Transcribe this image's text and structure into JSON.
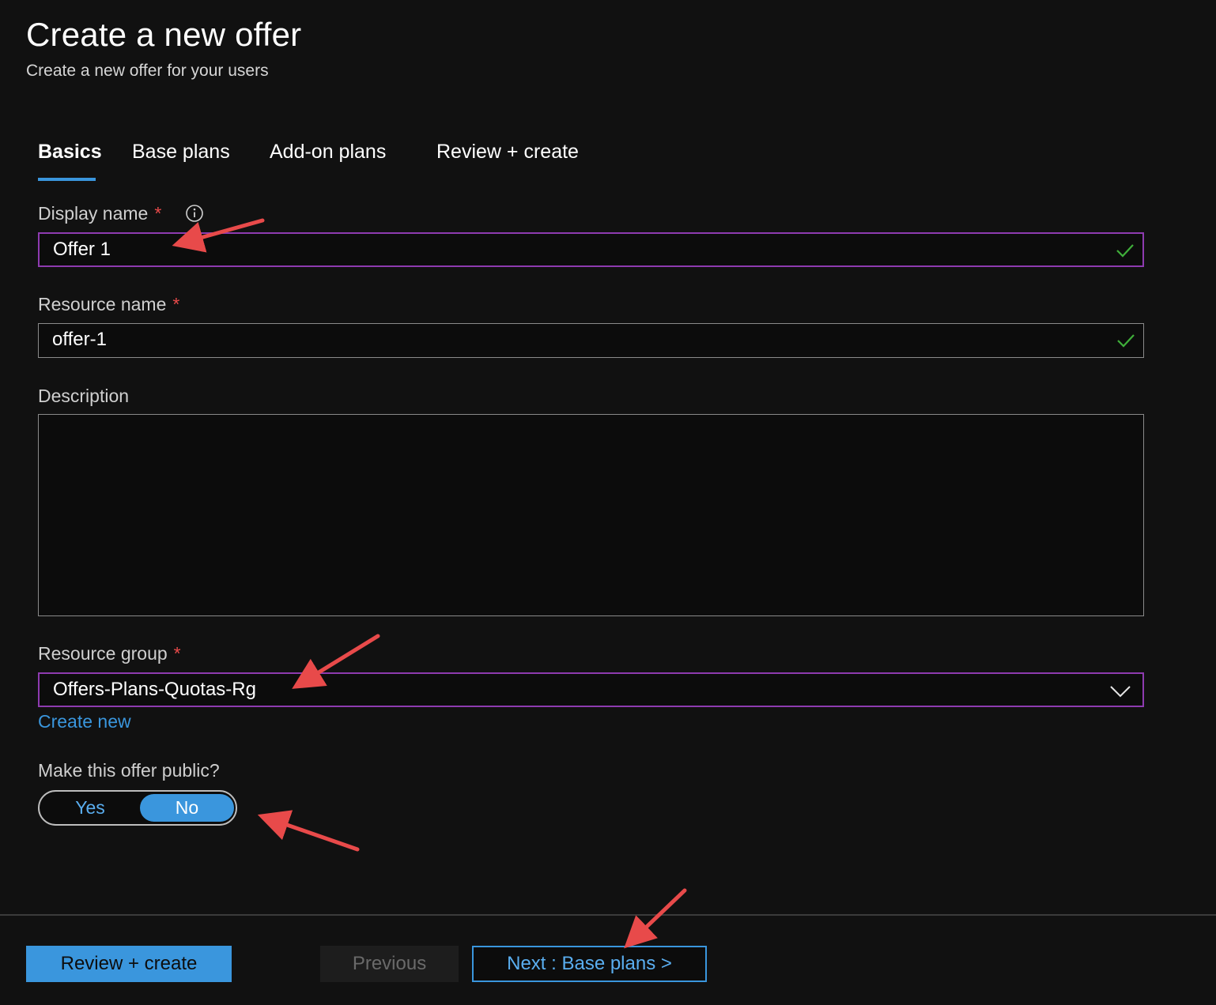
{
  "header": {
    "title": "Create a new offer",
    "subtitle": "Create a new offer for your users"
  },
  "tabs": [
    {
      "label": "Basics",
      "active": true
    },
    {
      "label": "Base plans",
      "active": false
    },
    {
      "label": "Add-on plans",
      "active": false
    },
    {
      "label": "Review + create",
      "active": false
    }
  ],
  "form": {
    "display_name": {
      "label": "Display name",
      "required_mark": "*",
      "value": "Offer 1",
      "icon": "info-icon",
      "status_icon": "checkmark-icon"
    },
    "resource_name": {
      "label": "Resource name",
      "required_mark": "*",
      "value": "offer-1",
      "status_icon": "checkmark-icon"
    },
    "description": {
      "label": "Description",
      "value": ""
    },
    "resource_group": {
      "label": "Resource group",
      "required_mark": "*",
      "value": "Offers-Plans-Quotas-Rg",
      "create_new_link": "Create new",
      "icon": "chevron-down-icon"
    },
    "make_public": {
      "label": "Make this offer public?",
      "options": [
        "Yes",
        "No"
      ],
      "selected": "No"
    }
  },
  "footer": {
    "review_create": "Review + create",
    "previous": "Previous",
    "next": "Next : Base plans >"
  },
  "colors": {
    "background": "#111111",
    "accent": "#3a96dd",
    "focus_border": "#8e3bb0",
    "valid_check": "#3fae3a",
    "required_star": "#e84a4a",
    "annotation_arrow": "#e84a4a"
  }
}
